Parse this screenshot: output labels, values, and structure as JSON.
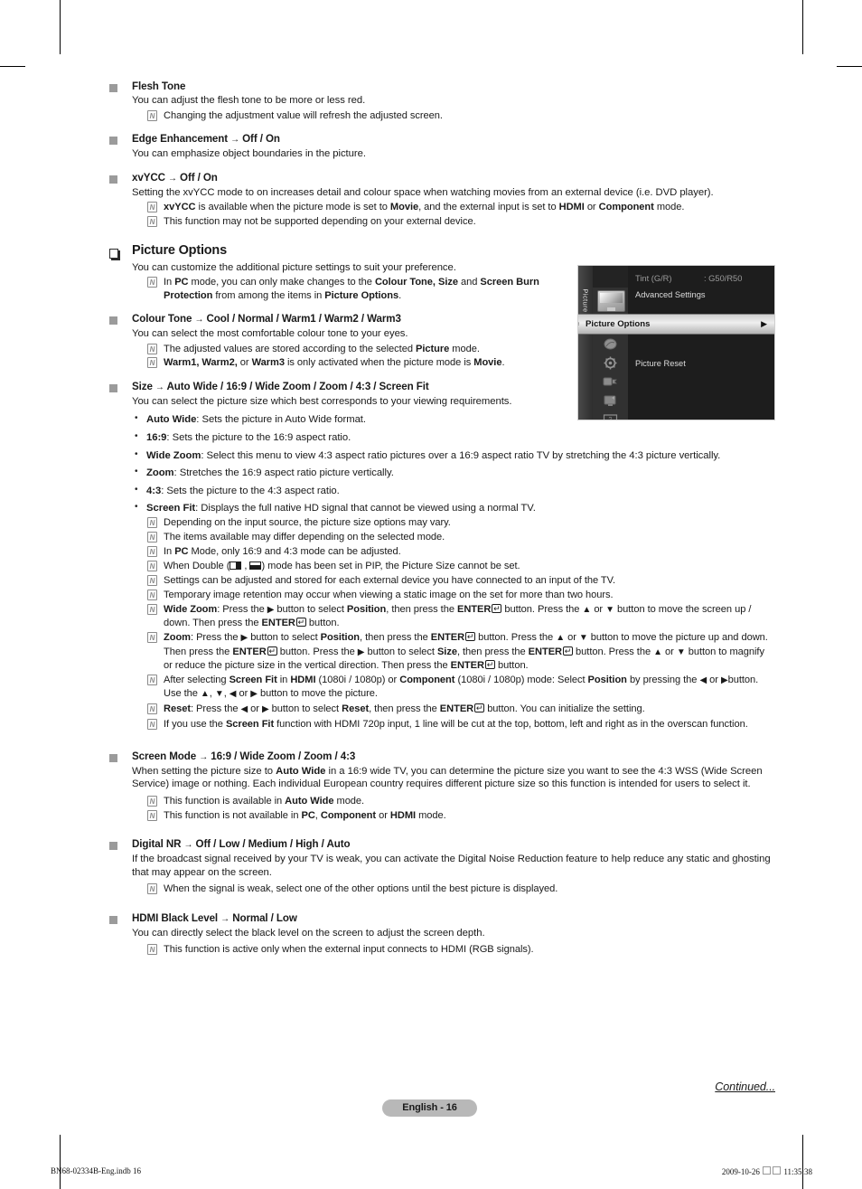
{
  "document": {
    "page_badge": "English - 16",
    "continued": "Continued...",
    "footer_left": "BN68-02334B-Eng.indb   16",
    "footer_right_date": "2009-10-26",
    "footer_right_time": "11:35:38"
  },
  "sections": [
    {
      "id": "flesh-tone",
      "marker": "square",
      "heading": "Flesh Tone",
      "body": "You can adjust the flesh tone to be more or less red.",
      "notes": [
        "Changing the adjustment value will refresh the adjusted screen."
      ]
    },
    {
      "id": "edge-enhancement",
      "marker": "square",
      "heading": "Edge Enhancement → Off / On",
      "body": "You can emphasize object boundaries in the picture.",
      "notes": []
    },
    {
      "id": "xvycc",
      "marker": "square",
      "heading": "xvYCC → Off / On",
      "body": "Setting the xvYCC mode to on increases detail and colour space when watching movies from an external device (i.e. DVD player).",
      "notes": [
        "xvYCC is available when the picture mode is set to Movie, and the external input is set to HDMI or Component mode.",
        "This function may not be supported depending on your external device."
      ]
    },
    {
      "id": "picture-options",
      "marker": "hollow-square",
      "heading": "Picture Options",
      "body": "You can customize the additional picture settings to suit your preference.",
      "notes": [
        "In PC mode, you can only make changes to the Colour Tone, Size and Screen Burn Protection from among the items in Picture Options."
      ]
    },
    {
      "id": "colour-tone",
      "marker": "square",
      "heading": "Colour Tone → Cool / Normal / Warm1 / Warm2 / Warm3",
      "body": "You can select the most comfortable colour tone to your eyes.",
      "notes": [
        "The adjusted values are stored according to the selected Picture mode.",
        "Warm1, Warm2, or Warm3 is only activated when the picture mode is Movie."
      ]
    },
    {
      "id": "size",
      "marker": "square",
      "heading": "Size → Auto Wide / 16:9 / Wide Zoom / Zoom / 4:3 / Screen Fit",
      "body": "You can select the picture size which best corresponds to your viewing requirements.",
      "bullets": [
        {
          "term": "Auto Wide",
          "text": ": Sets the picture in Auto Wide format."
        },
        {
          "term": "16:9",
          "text": ": Sets the picture to the 16:9 aspect ratio."
        },
        {
          "term": "Wide Zoom",
          "text": ": Select this menu to view 4:3 aspect ratio pictures over a 16:9 aspect ratio TV by stretching the 4:3 picture vertically."
        },
        {
          "term": "Zoom",
          "text": ": Stretches the 16:9 aspect ratio picture vertically."
        },
        {
          "term": "4:3",
          "text": ": Sets the picture to the 4:3 aspect ratio."
        },
        {
          "term": "Screen Fit",
          "text": ": Displays the full native HD signal that cannot be viewed using a normal TV."
        }
      ],
      "sub_notes": [
        "Depending on the input source, the picture size options may vary.",
        "The items available may differ depending on the selected mode.",
        "In PC Mode, only 16:9 and 4:3 mode can be adjusted.",
        "When Double ( , ) mode has been set in PIP, the Picture Size cannot be set.",
        "Settings can be adjusted and stored for each external device you have connected to an input of the TV.",
        "Temporary image retention may occur when viewing a static image on the set for more than two hours.",
        "Wide Zoom: Press the ▶ button to select Position, then press the ENTER button. Press the ▲ or ▼ button to move the screen up / down. Then press the ENTER button.",
        "Zoom: Press the ▶ button to select Position, then press the ENTER button. Press the ▲ or ▼ button to move the picture up and down. Then press the ENTER button. Press the ▶ button to select Size, then press the ENTER button. Press the ▲ or ▼ button to magnify or reduce the picture size in the vertical direction. Then press the ENTER button.",
        "After selecting Screen Fit in HDMI (1080i / 1080p) or Component (1080i / 1080p) mode: Select Position by pressing the ◀ or ▶button. Use the ▲, ▼, ◀ or ▶ button to move the picture.",
        "Reset: Press the ◀ or ▶ button to select Reset, then press the ENTER button. You can initialize the setting.",
        "If you use the Screen Fit function with HDMI 720p input, 1 line will be cut at the top, bottom, left and right as in the overscan function."
      ]
    },
    {
      "id": "screen-mode",
      "marker": "square",
      "heading": "Screen Mode → 16:9 / Wide Zoom / Zoom / 4:3",
      "body": "When setting the picture size to Auto Wide in a 16:9 wide TV, you can determine the picture size you want to see the 4:3 WSS (Wide Screen Service) image or nothing. Each individual European country requires different picture size so this function is intended for users to select it.",
      "notes": [
        "This function is available in Auto Wide mode.",
        "This function is not available in PC, Component or HDMI mode."
      ]
    },
    {
      "id": "digital-nr",
      "marker": "square",
      "heading": "Digital NR → Off / Low / Medium / High / Auto",
      "body": "If the broadcast signal received by your TV is weak, you can activate the Digital Noise Reduction feature to help reduce any static and ghosting that may appear on the screen.",
      "notes": [
        "When the signal is weak, select one of the other options until the best picture is displayed."
      ]
    },
    {
      "id": "hdmi-black-level",
      "marker": "square",
      "heading": "HDMI Black Level → Normal / Low",
      "body": "You can directly select the black level on the screen to adjust the screen depth.",
      "notes": [
        "This function is active only when the external input connects to HDMI (RGB signals)."
      ]
    }
  ],
  "osd": {
    "tab_label": "Picture",
    "items": [
      {
        "label": "Tint (G/R)",
        "value": ": G50/R50"
      },
      {
        "label": "Advanced Settings",
        "value": ""
      },
      {
        "label": "Picture Reset",
        "value": ""
      }
    ],
    "selected": {
      "label": "Picture Options",
      "arrow": "▶",
      "left_marker": "‹"
    },
    "icon_names": [
      "picture-icon",
      "sound-icon",
      "channel-icon",
      "setup-icon",
      "input-icon",
      "application-icon",
      "support-icon"
    ]
  }
}
